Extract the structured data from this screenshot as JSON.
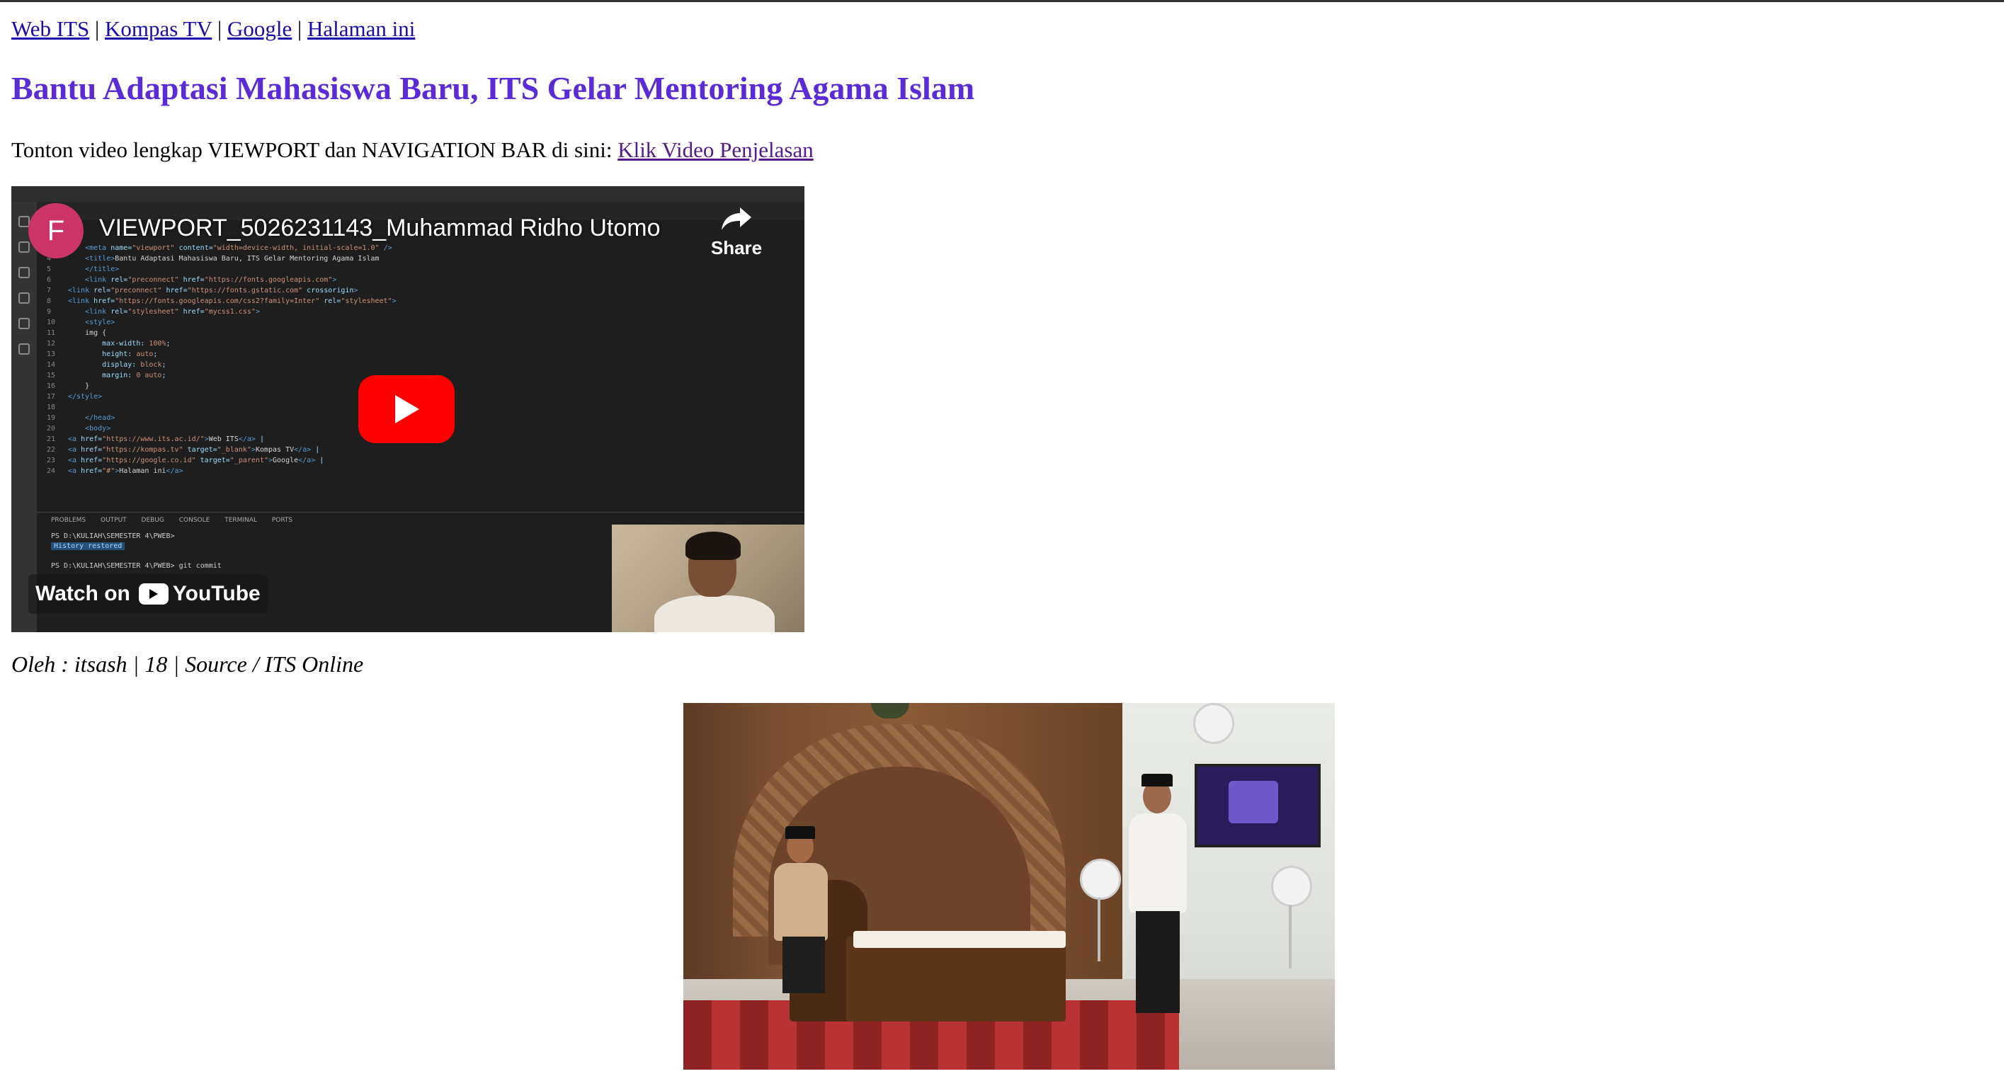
{
  "nav": {
    "links": [
      "Web ITS",
      "Kompas TV",
      "Google",
      "Halaman ini"
    ],
    "separator": "|"
  },
  "article": {
    "title": "Bantu Adaptasi Mahasiswa Baru, ITS Gelar Mentoring Agama Islam",
    "title_color": "#5a2bd6",
    "intro_text": "Tonton video lengkap VIEWPORT dan NAVIGATION BAR di sini: ",
    "intro_link": "Klik Video Penjelasan",
    "byline": "Oleh : itsash | 18 | Source / ITS Online"
  },
  "video": {
    "channel_initial": "F",
    "channel_color": "#cc3366",
    "title": "VIEWPORT_5026231143_Muhammad Ridho Utomo",
    "share_label": "Share",
    "watch_on_label": "Watch on",
    "platform_label": "YouTube",
    "play_button_color": "#ff0000"
  },
  "photo": {
    "icon": "mosque-event-photo"
  }
}
